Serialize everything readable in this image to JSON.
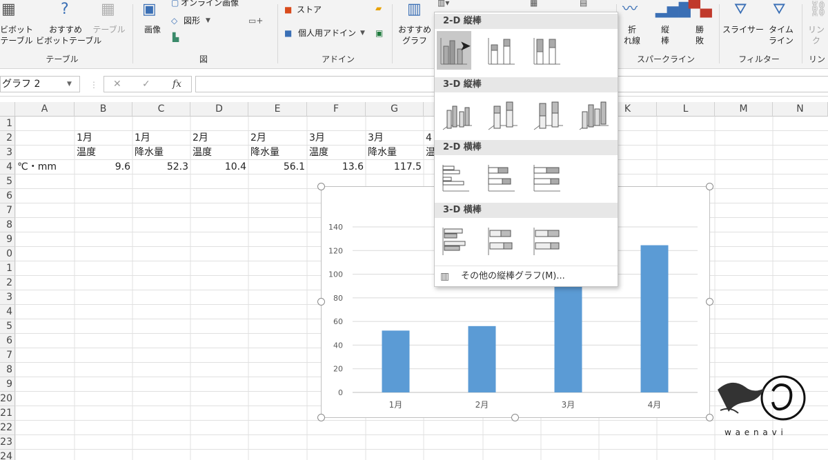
{
  "ribbon": {
    "table_group": {
      "pivot": "ビボット\nテーブル",
      "rec_pivot": "おすすめ\nビボットテーブル",
      "table": "テーブル",
      "label": "テーブル"
    },
    "illust_group": {
      "picture": "画像",
      "online_picture": "オンライン画像",
      "shapes": "図形",
      "label": "図"
    },
    "addin_group": {
      "store": "ストア",
      "my_addins": "個人用アドイン",
      "label": "アドイン"
    },
    "charts": {
      "rec_chart": "おすすめ\nグラフ"
    },
    "sparkline_group": {
      "line": "折\nれ線",
      "column": "縦\n棒",
      "winloss": "勝\n敗",
      "label": "スパークライン"
    },
    "filter_group": {
      "slicer": "スライサー",
      "timeline": "タイム\nライン",
      "label": "フィルター"
    },
    "link_group": {
      "link": "リン\nク",
      "label": "リン"
    }
  },
  "formula_bar": {
    "name_box": "グラフ 2",
    "cancel": "✕",
    "enter": "✓",
    "fx": "fx",
    "value": ""
  },
  "sheet": {
    "columns": [
      "A",
      "B",
      "C",
      "D",
      "E",
      "F",
      "G",
      "H",
      "I",
      "J",
      "K",
      "L",
      "M",
      "N"
    ],
    "rows": [
      "1",
      "2",
      "3",
      "4",
      "5",
      "6",
      "7",
      "8",
      "9",
      "0",
      "1",
      "2",
      "3",
      "4",
      "5",
      "6",
      "7",
      "8",
      "9",
      "20",
      "21",
      "22",
      "23",
      "24"
    ],
    "row2": [
      "1月",
      "1月",
      "2月",
      "2月",
      "3月",
      "3月",
      "4"
    ],
    "row3": [
      "温度",
      "降水量",
      "温度",
      "降水量",
      "温度",
      "降水量",
      "温"
    ],
    "row4_label": "℃・mm",
    "row4_values": [
      "9.6",
      "52.3",
      "10.4",
      "56.1",
      "13.6",
      "117.5"
    ]
  },
  "chart_data": {
    "type": "bar",
    "title": "",
    "categories": [
      "1月",
      "2月",
      "3月",
      "4月"
    ],
    "values": [
      52.3,
      56.1,
      117.5,
      124.5
    ],
    "ylim": [
      0,
      140
    ],
    "yticks": [
      "0",
      "20",
      "40",
      "60",
      "80",
      "100",
      "120",
      "140"
    ],
    "grid": true,
    "bar_color": "#5b9bd5"
  },
  "dropdown": {
    "sec_2d_column": "2-D 縦棒",
    "sec_3d_column": "3-D 縦棒",
    "sec_2d_bar": "2-D 横棒",
    "sec_3d_bar": "3-D 横棒",
    "more": "その他の縦棒グラフ(M)..."
  },
  "logo": {
    "text": "w a e n a v i"
  },
  "colors": {
    "accent": "#5b9bd5",
    "header_bg": "#f2f2f2",
    "ribbon_bg": "#f3f3f3"
  }
}
